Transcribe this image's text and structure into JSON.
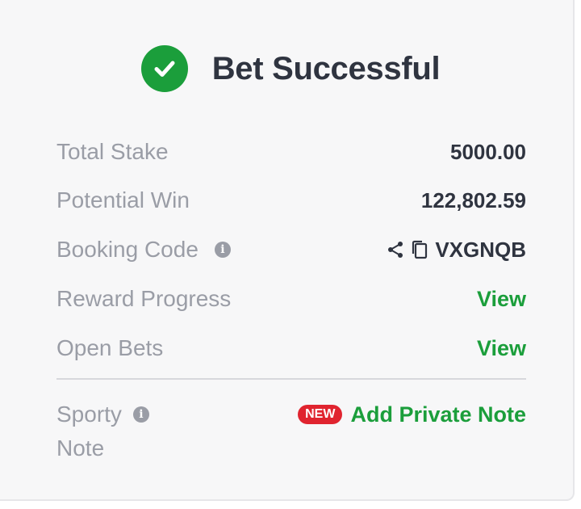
{
  "header": {
    "title": "Bet Successful"
  },
  "rows": {
    "total_stake": {
      "label": "Total Stake",
      "value": "5000.00"
    },
    "potential_win": {
      "label": "Potential Win",
      "value": "122,802.59"
    },
    "booking_code": {
      "label": "Booking Code",
      "value": "VXGNQB"
    },
    "reward_progress": {
      "label": "Reward Progress",
      "action": "View"
    },
    "open_bets": {
      "label": "Open Bets",
      "action": "View"
    }
  },
  "note": {
    "label_line1": "Sporty",
    "label_line2": "Note",
    "badge": "NEW",
    "action": "Add Private Note"
  },
  "icons": {
    "success": "check-circle-icon",
    "info": "info-icon",
    "share": "share-icon",
    "copy": "copy-icon"
  },
  "colors": {
    "accent_green": "#1b9e3b",
    "badge_red": "#e0242f",
    "label_gray": "#9a9da6",
    "value_dark": "#2f3440"
  }
}
